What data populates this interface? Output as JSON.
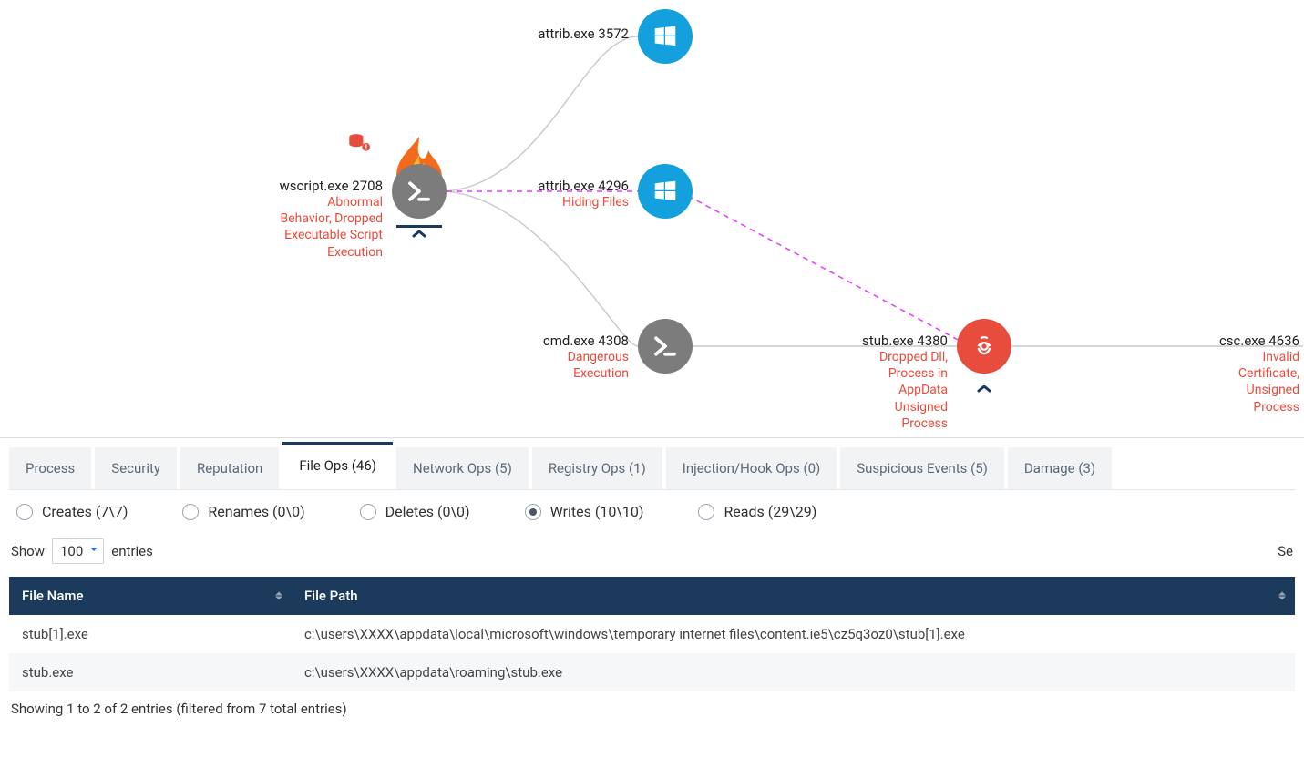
{
  "graph": {
    "nodes": [
      {
        "id": "wscript",
        "name": "wscript.exe 2708",
        "alert": "Abnormal Behavior, Dropped Executable\nScript Execution",
        "icon": "terminal",
        "color": "gray",
        "flame": true,
        "db_alert": true,
        "underline": true,
        "chev": true
      },
      {
        "id": "attrib1",
        "name": "attrib.exe 3572",
        "alert": "",
        "icon": "windows",
        "color": "blue"
      },
      {
        "id": "attrib2",
        "name": "attrib.exe 4296",
        "alert": "Hiding Files",
        "icon": "windows",
        "color": "blue"
      },
      {
        "id": "cmd",
        "name": "cmd.exe 4308",
        "alert": "Dangerous Execution",
        "icon": "terminal",
        "color": "gray"
      },
      {
        "id": "stub",
        "name": "stub.exe 4380",
        "alert": "Dropped Dll, Process in AppData\nUnsigned Process",
        "icon": "biohazard",
        "color": "red",
        "chev": true
      },
      {
        "id": "csc",
        "name": "csc.exe 4636",
        "alert": "Invalid Certificate, Unsigned Process",
        "icon": "none",
        "color": "none"
      }
    ],
    "edges": [
      {
        "from": "wscript",
        "to": "attrib1",
        "style": "solid"
      },
      {
        "from": "wscript",
        "to": "attrib2",
        "style": "dashed"
      },
      {
        "from": "wscript",
        "to": "cmd",
        "style": "solid"
      },
      {
        "from": "attrib2",
        "to": "stub",
        "style": "dashed"
      },
      {
        "from": "cmd",
        "to": "stub",
        "style": "solid"
      },
      {
        "from": "stub",
        "to": "csc",
        "style": "solid"
      }
    ]
  },
  "tabs": [
    {
      "label": "Process",
      "active": false
    },
    {
      "label": "Security",
      "active": false
    },
    {
      "label": "Reputation",
      "active": false
    },
    {
      "label": "File Ops (46)",
      "active": true
    },
    {
      "label": "Network Ops (5)",
      "active": false
    },
    {
      "label": "Registry Ops (1)",
      "active": false
    },
    {
      "label": "Injection/Hook Ops (0)",
      "active": false
    },
    {
      "label": "Suspicious Events (5)",
      "active": false
    },
    {
      "label": "Damage (3)",
      "active": false
    }
  ],
  "filters": {
    "selected": "writes",
    "items": [
      {
        "id": "creates",
        "label": "Creates (7\\7)"
      },
      {
        "id": "renames",
        "label": "Renames (0\\0)"
      },
      {
        "id": "deletes",
        "label": "Deletes (0\\0)"
      },
      {
        "id": "writes",
        "label": "Writes (10\\10)"
      },
      {
        "id": "reads",
        "label": "Reads (29\\29)"
      }
    ]
  },
  "toolbar": {
    "show_label": "Show",
    "entries_label": "entries",
    "page_size": "100",
    "search_label": "Se"
  },
  "table": {
    "columns": [
      "File Name",
      "File Path"
    ],
    "rows": [
      {
        "name": "stub[1].exe",
        "path": "c:\\users\\XXXX\\appdata\\local\\microsoft\\windows\\temporary internet files\\content.ie5\\cz5q3oz0\\stub[1].exe"
      },
      {
        "name": "stub.exe",
        "path": "c:\\users\\XXXX\\appdata\\roaming\\stub.exe"
      }
    ]
  },
  "footer": "Showing 1 to 2 of 2 entries (filtered from 7 total entries)"
}
